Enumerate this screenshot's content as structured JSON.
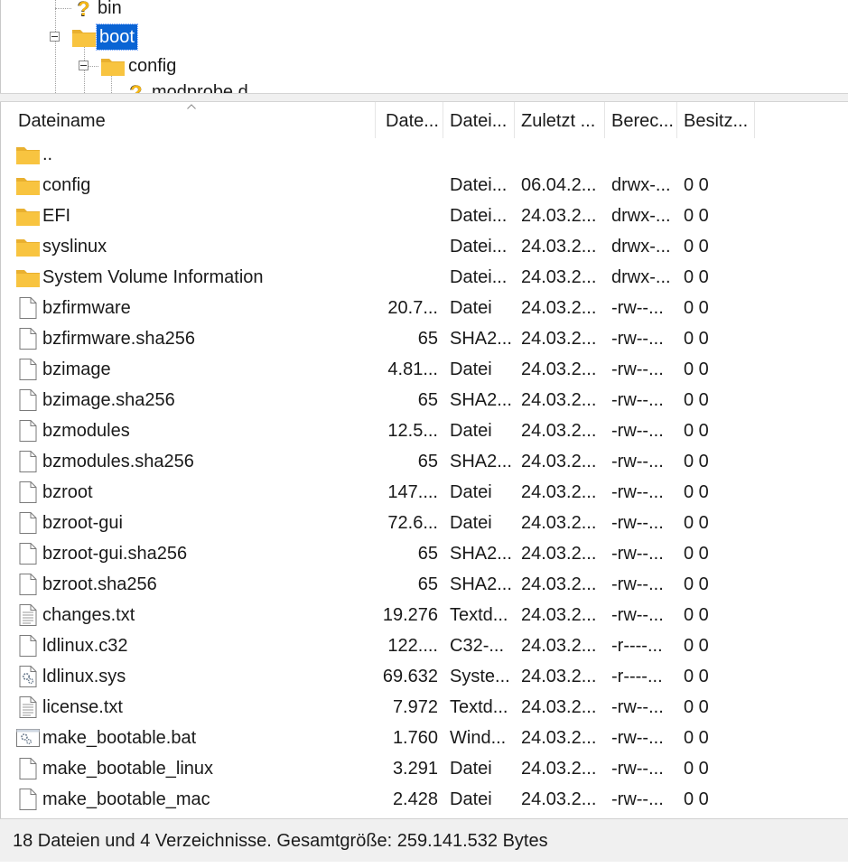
{
  "tree": {
    "nodes": [
      {
        "label": "bin",
        "icon": "unknown-folder-icon",
        "selected": false
      },
      {
        "label": "boot",
        "icon": "folder-icon",
        "selected": true
      },
      {
        "label": "config",
        "icon": "folder-icon",
        "selected": false
      },
      {
        "label": "modprobe.d",
        "icon": "unknown-folder-icon",
        "selected": false
      }
    ]
  },
  "columns": {
    "name": "Dateiname",
    "size": "Date...",
    "type": "Datei...",
    "modified": "Zuletzt ...",
    "permissions": "Berec...",
    "owner": "Besitz..."
  },
  "files": [
    {
      "name": "..",
      "size": "",
      "type": "",
      "modified": "",
      "permissions": "",
      "owner": "",
      "icon": "folder-icon"
    },
    {
      "name": "config",
      "size": "",
      "type": "Datei...",
      "modified": "06.04.2...",
      "permissions": "drwx-...",
      "owner": "0 0",
      "icon": "folder-icon"
    },
    {
      "name": "EFI",
      "size": "",
      "type": "Datei...",
      "modified": "24.03.2...",
      "permissions": "drwx-...",
      "owner": "0 0",
      "icon": "folder-icon"
    },
    {
      "name": "syslinux",
      "size": "",
      "type": "Datei...",
      "modified": "24.03.2...",
      "permissions": "drwx-...",
      "owner": "0 0",
      "icon": "folder-icon"
    },
    {
      "name": "System Volume Information",
      "size": "",
      "type": "Datei...",
      "modified": "24.03.2...",
      "permissions": "drwx-...",
      "owner": "0 0",
      "icon": "folder-icon"
    },
    {
      "name": "bzfirmware",
      "size": "20.7...",
      "type": "Datei",
      "modified": "24.03.2...",
      "permissions": "-rw--...",
      "owner": "0 0",
      "icon": "file-icon"
    },
    {
      "name": "bzfirmware.sha256",
      "size": "65",
      "type": "SHA2...",
      "modified": "24.03.2...",
      "permissions": "-rw--...",
      "owner": "0 0",
      "icon": "file-icon"
    },
    {
      "name": "bzimage",
      "size": "4.81...",
      "type": "Datei",
      "modified": "24.03.2...",
      "permissions": "-rw--...",
      "owner": "0 0",
      "icon": "file-icon"
    },
    {
      "name": "bzimage.sha256",
      "size": "65",
      "type": "SHA2...",
      "modified": "24.03.2...",
      "permissions": "-rw--...",
      "owner": "0 0",
      "icon": "file-icon"
    },
    {
      "name": "bzmodules",
      "size": "12.5...",
      "type": "Datei",
      "modified": "24.03.2...",
      "permissions": "-rw--...",
      "owner": "0 0",
      "icon": "file-icon"
    },
    {
      "name": "bzmodules.sha256",
      "size": "65",
      "type": "SHA2...",
      "modified": "24.03.2...",
      "permissions": "-rw--...",
      "owner": "0 0",
      "icon": "file-icon"
    },
    {
      "name": "bzroot",
      "size": "147....",
      "type": "Datei",
      "modified": "24.03.2...",
      "permissions": "-rw--...",
      "owner": "0 0",
      "icon": "file-icon"
    },
    {
      "name": "bzroot-gui",
      "size": "72.6...",
      "type": "Datei",
      "modified": "24.03.2...",
      "permissions": "-rw--...",
      "owner": "0 0",
      "icon": "file-icon"
    },
    {
      "name": "bzroot-gui.sha256",
      "size": "65",
      "type": "SHA2...",
      "modified": "24.03.2...",
      "permissions": "-rw--...",
      "owner": "0 0",
      "icon": "file-icon"
    },
    {
      "name": "bzroot.sha256",
      "size": "65",
      "type": "SHA2...",
      "modified": "24.03.2...",
      "permissions": "-rw--...",
      "owner": "0 0",
      "icon": "file-icon"
    },
    {
      "name": "changes.txt",
      "size": "19.276",
      "type": "Textd...",
      "modified": "24.03.2...",
      "permissions": "-rw--...",
      "owner": "0 0",
      "icon": "text-file-icon"
    },
    {
      "name": "ldlinux.c32",
      "size": "122....",
      "type": "C32-...",
      "modified": "24.03.2...",
      "permissions": "-r----...",
      "owner": "0 0",
      "icon": "file-icon"
    },
    {
      "name": "ldlinux.sys",
      "size": "69.632",
      "type": "Syste...",
      "modified": "24.03.2...",
      "permissions": "-r----...",
      "owner": "0 0",
      "icon": "system-file-icon"
    },
    {
      "name": "license.txt",
      "size": "7.972",
      "type": "Textd...",
      "modified": "24.03.2...",
      "permissions": "-rw--...",
      "owner": "0 0",
      "icon": "text-file-icon"
    },
    {
      "name": "make_bootable.bat",
      "size": "1.760",
      "type": "Wind...",
      "modified": "24.03.2...",
      "permissions": "-rw--...",
      "owner": "0 0",
      "icon": "batch-file-icon"
    },
    {
      "name": "make_bootable_linux",
      "size": "3.291",
      "type": "Datei",
      "modified": "24.03.2...",
      "permissions": "-rw--...",
      "owner": "0 0",
      "icon": "file-icon"
    },
    {
      "name": "make_bootable_mac",
      "size": "2.428",
      "type": "Datei",
      "modified": "24.03.2...",
      "permissions": "-rw--...",
      "owner": "0 0",
      "icon": "file-icon"
    }
  ],
  "status": {
    "text": "18 Dateien und 4 Verzeichnisse. Gesamtgröße: 259.141.532 Bytes"
  },
  "colors": {
    "selection": "#0a64d4",
    "folder": "#f8c440",
    "status_bg": "#f0f0f0"
  }
}
